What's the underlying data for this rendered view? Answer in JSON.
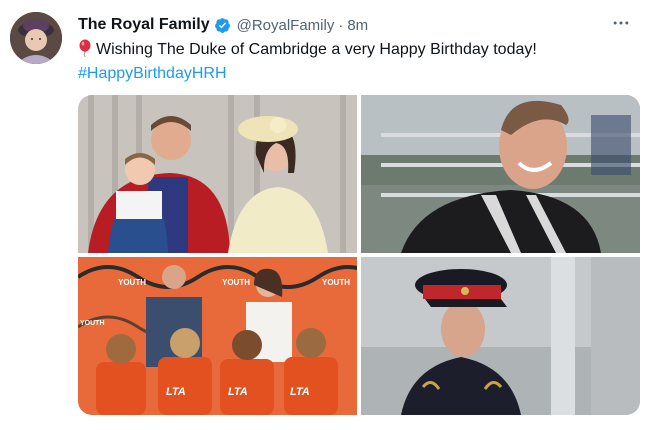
{
  "tweet": {
    "author_name": "The Royal Family",
    "handle": "@RoyalFamily",
    "separator": "·",
    "time": "8m",
    "text": "Wishing The Duke of Cambridge a very Happy Birthday today!",
    "hashtag": "#HappyBirthdayHRH",
    "icons": {
      "verified": "verified-badge-icon",
      "more": "more-options-icon",
      "emoji": "balloon-icon"
    },
    "photo_texts": {
      "banner_word": "YOUTH",
      "shirt_logo": "LTA"
    }
  },
  "colors": {
    "accent": "#1d9bf0",
    "text": "#0f1419",
    "muted": "#536471"
  }
}
